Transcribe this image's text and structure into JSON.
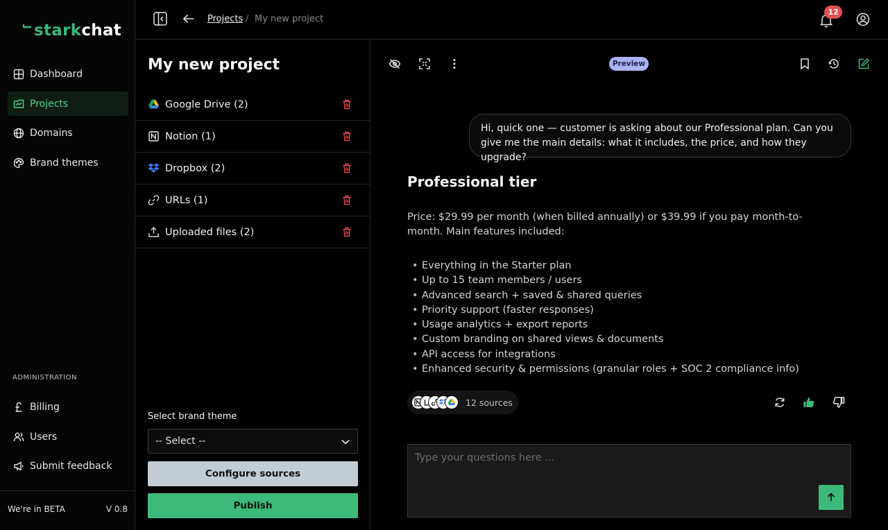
{
  "brand": {
    "part1": "stark",
    "part2": "chat"
  },
  "nav": {
    "items": [
      {
        "label": "Dashboard",
        "icon": "grid-icon"
      },
      {
        "label": "Projects",
        "icon": "folder-icon",
        "active": true
      },
      {
        "label": "Domains",
        "icon": "globe-icon"
      },
      {
        "label": "Brand themes",
        "icon": "palette-icon"
      }
    ],
    "admin_label": "ADMINISTRATION",
    "admin_items": [
      {
        "label": "Billing",
        "icon": "pound-icon"
      },
      {
        "label": "Users",
        "icon": "users-icon"
      },
      {
        "label": "Submit feedback",
        "icon": "megaphone-icon"
      }
    ],
    "beta": "We're in BETA",
    "version": "V 0.8"
  },
  "topbar": {
    "breadcrumb_link": "Projects",
    "breadcrumb_sep": "/",
    "breadcrumb_current": "My new project",
    "notification_count": "12"
  },
  "panel": {
    "title": "My new project",
    "sources": [
      {
        "label": "Google Drive (2)",
        "icon": "google-drive-icon"
      },
      {
        "label": "Notion (1)",
        "icon": "notion-icon"
      },
      {
        "label": "Dropbox (2)",
        "icon": "dropbox-icon"
      },
      {
        "label": "URLs (1)",
        "icon": "link-icon"
      },
      {
        "label": "Uploaded files (2)",
        "icon": "upload-icon"
      }
    ],
    "brand_theme_label": "Select brand theme",
    "select_value": "-- Select --",
    "configure_label": "Configure sources",
    "publish_label": "Publish"
  },
  "chat": {
    "preview_label": "Preview",
    "user_message": "Hi, quick one — customer is asking about our Professional plan. Can you give me the main details: what it includes, the price, and how they upgrade?",
    "answer_title": "Professional tier",
    "answer_paragraph": "Price: $29.99 per month (when billed annually) or $39.99 if you pay month-to-month. Main features included:",
    "features": [
      "Everything in the Starter plan",
      "Up to 15 team members / users",
      "Advanced search + saved & shared queries",
      "Priority support (faster responses)",
      "Usage analytics + export reports",
      "Custom branding on shared views & documents",
      "API access for integrations",
      "Enhanced security & permissions (granular roles + SOC 2 compliance info)"
    ],
    "sources_count": "12 sources",
    "input_placeholder": "Type your questions here ...",
    "accent": "#3dba7a"
  }
}
